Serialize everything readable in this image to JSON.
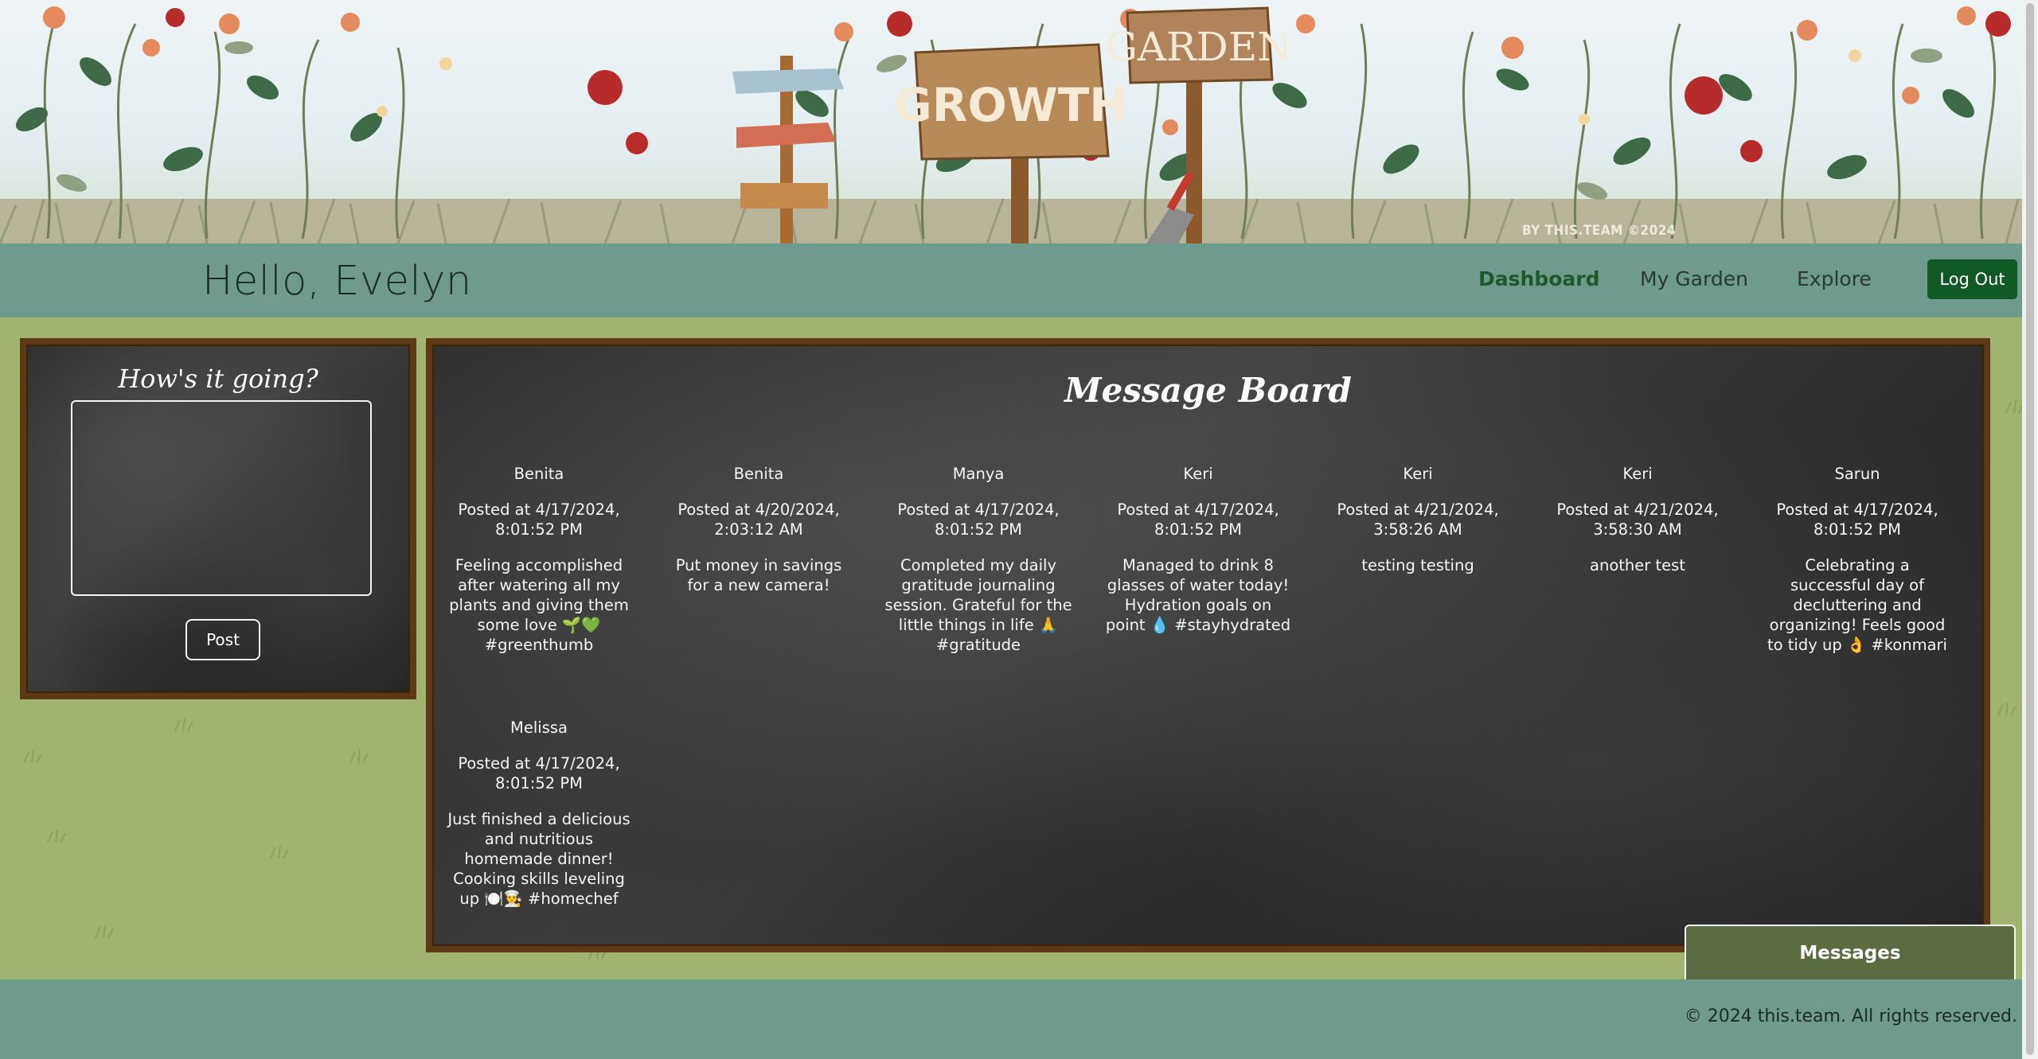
{
  "banner": {
    "sign_growth": "GROWTH",
    "sign_garden": "GARDEN",
    "credit": "BY THIS.TEAM ©2024"
  },
  "nav": {
    "greeting": "Hello, Evelyn",
    "links": [
      "Dashboard",
      "My Garden",
      "Explore"
    ],
    "active": "Dashboard",
    "logout": "Log Out"
  },
  "compose": {
    "title": "How's it going?",
    "textarea_value": "",
    "post_button": "Post"
  },
  "message_board": {
    "title": "Message Board",
    "posts": [
      {
        "author": "Benita",
        "time": "Posted at 4/17/2024, 8:01:52 PM",
        "body": "Feeling accomplished after watering all my plants and giving them some love 🌱💚 #greenthumb"
      },
      {
        "author": "Benita",
        "time": "Posted at 4/20/2024, 2:03:12 AM",
        "body": "Put money in savings for a new camera!"
      },
      {
        "author": "Manya",
        "time": "Posted at 4/17/2024, 8:01:52 PM",
        "body": "Completed my daily gratitude journaling session. Grateful for the little things in life 🙏 #gratitude"
      },
      {
        "author": "Keri",
        "time": "Posted at 4/17/2024, 8:01:52 PM",
        "body": "Managed to drink 8 glasses of water today! Hydration goals on point 💧 #stayhydrated"
      },
      {
        "author": "Keri",
        "time": "Posted at 4/21/2024, 3:58:26 AM",
        "body": "testing testing"
      },
      {
        "author": "Keri",
        "time": "Posted at 4/21/2024, 3:58:30 AM",
        "body": "another test"
      },
      {
        "author": "Sarun",
        "time": "Posted at 4/17/2024, 8:01:52 PM",
        "body": "Celebrating a successful day of decluttering and organizing! Feels good to tidy up 👌 #konmari"
      },
      {
        "author": "Melissa",
        "time": "Posted at 4/17/2024, 8:01:52 PM",
        "body": "Just finished a delicious and nutritious homemade dinner! Cooking skills leveling up 🍽️👨‍🍳 #homechef"
      }
    ]
  },
  "messages_tab": "Messages",
  "footer": {
    "copyright": "© 2024 this.team. All rights reserved."
  },
  "colors": {
    "nav": "#6f9a8e",
    "grass": "#a0b36f",
    "board_frame": "#5b3a15",
    "active_link": "#1b5a2a",
    "logout": "#0f5a27",
    "messages_tab": "#5b6b42"
  }
}
